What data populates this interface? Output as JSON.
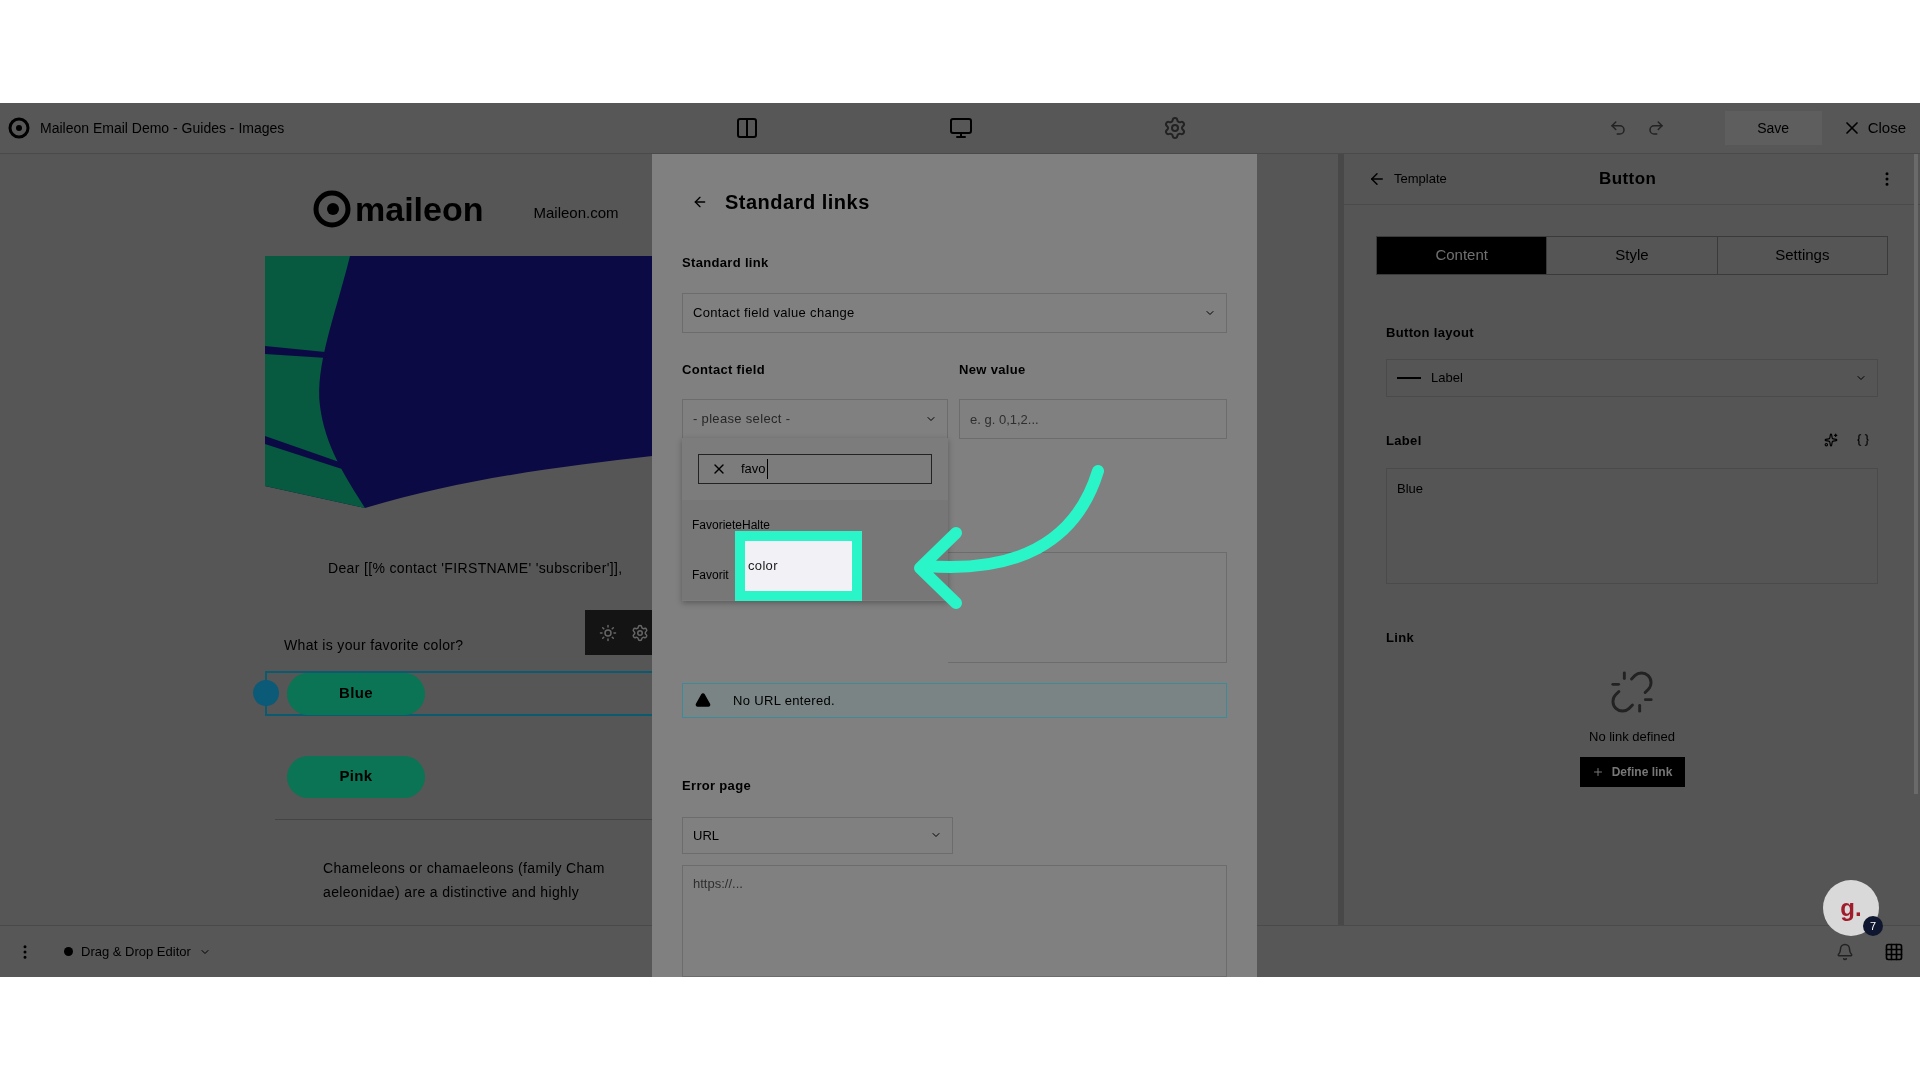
{
  "top_bar": {
    "title": "Maileon Email Demo - Guides - Images",
    "save": "Save",
    "close": "Close"
  },
  "canvas": {
    "logo": "maileon",
    "site_link": "Maileon.com",
    "banner": {
      "kind": "picture"
    },
    "greeting": "Dear [[% contact 'FIRSTNAME' 'subscriber']],",
    "question": "What is your favorite color?",
    "buttons": [
      {
        "label": "Blue",
        "selected": true
      },
      {
        "label": "Pink",
        "selected": false
      }
    ],
    "paragraph_lines": [
      "Chameleons or chamaeleons (family Cham",
      "aeleonidae) are a distinctive and highly"
    ]
  },
  "right_panel": {
    "back": "Template",
    "title": "Button",
    "tabs": [
      {
        "label": "Content",
        "selected": true
      },
      {
        "label": "Style",
        "selected": false
      },
      {
        "label": "Settings",
        "selected": false
      }
    ],
    "layout_label": "Button layout",
    "layout_value": "Label",
    "label_label": "Label",
    "label_value": "Blue",
    "link_label": "Link",
    "no_link": "No link defined",
    "define_link": "Define link"
  },
  "bottom_bar": {
    "editor": "Drag & Drop Editor"
  },
  "modal": {
    "title": "Standard links",
    "standard_link_label": "Standard link",
    "standard_link_value": "Contact field value change",
    "contact_field_label": "Contact field",
    "contact_field_placeholder": "- please select -",
    "new_value_label": "New value",
    "new_value_placeholder": "e. g. 0,1,2...",
    "dropdown": {
      "search": "favo",
      "options": [
        {
          "label": "FavorieteHalte"
        },
        {
          "label": "Favorit"
        }
      ]
    },
    "notice": "No URL entered.",
    "error_page_label": "Error page",
    "error_page_value": "URL",
    "url_placeholder": "https://..."
  },
  "guide": {
    "highlight": "color",
    "badge": "g.",
    "count": "7"
  }
}
